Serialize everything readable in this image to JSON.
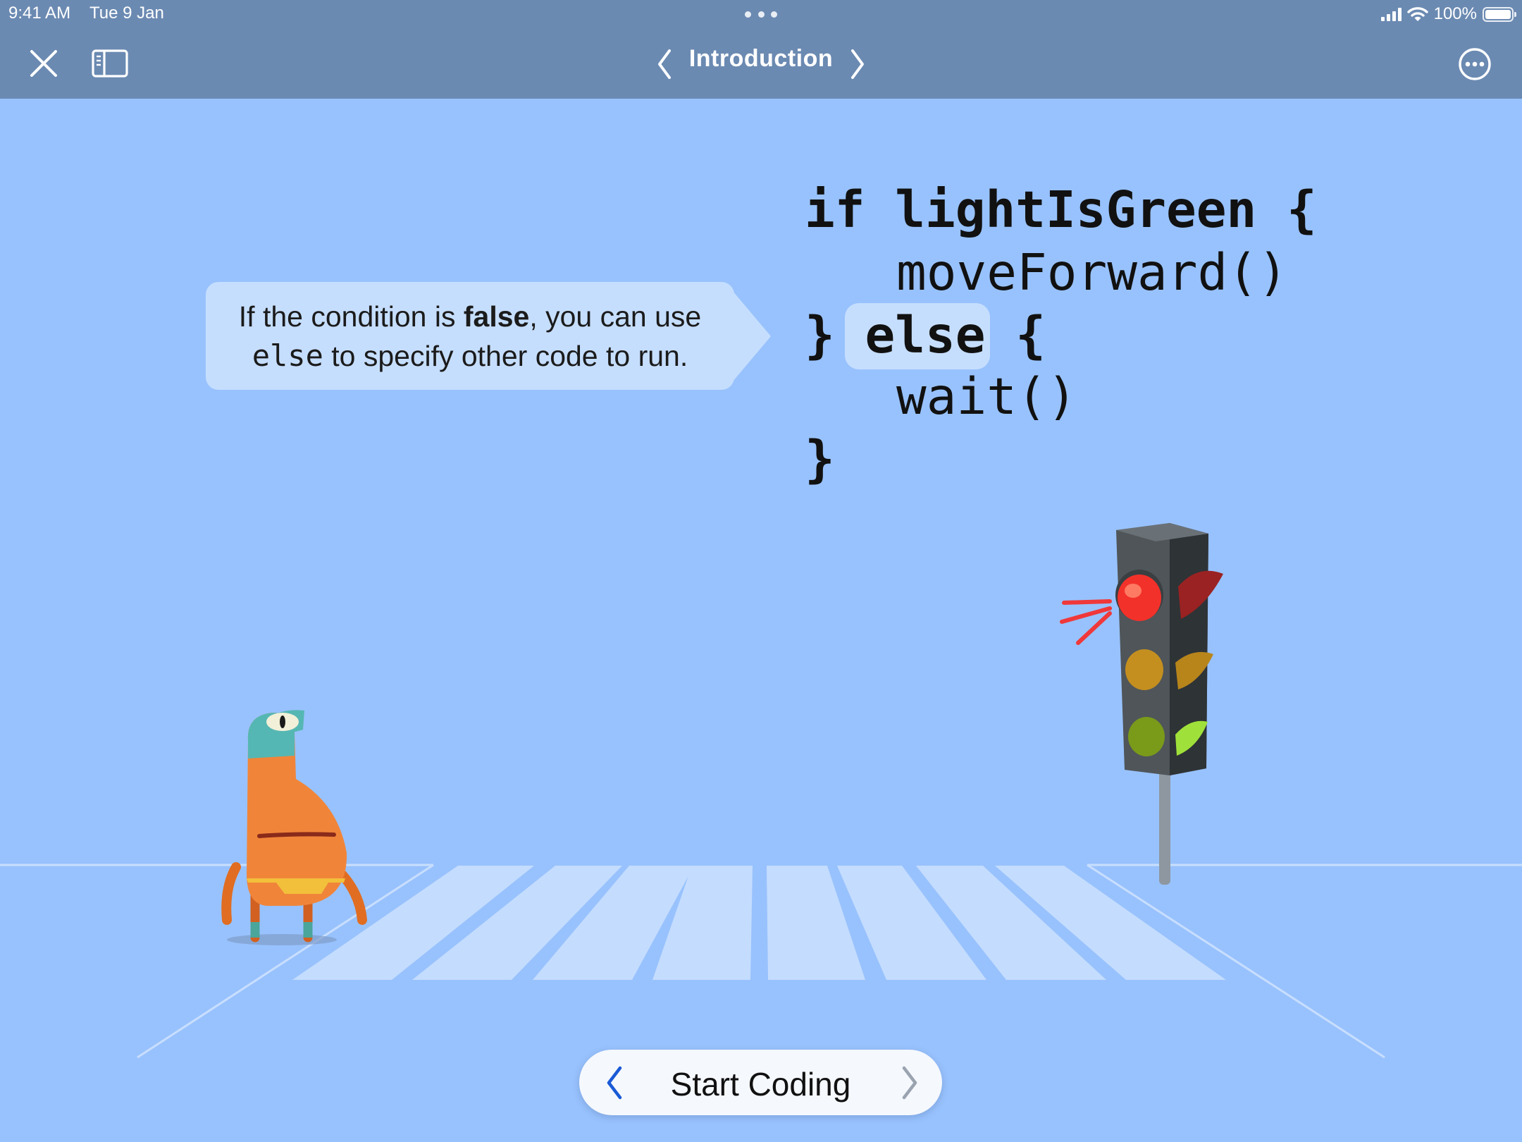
{
  "status_bar": {
    "time": "9:41 AM",
    "date": "Tue 9 Jan",
    "battery": "100%",
    "icons": [
      "signal-icon",
      "wifi-icon",
      "battery-icon"
    ]
  },
  "nav": {
    "title": "Introduction",
    "close_icon": "close-icon",
    "sidebar_icon": "sidebar-toggle-icon",
    "prev_icon": "chevron-left-icon",
    "next_icon": "chevron-right-icon",
    "more_icon": "ellipsis-circle-icon"
  },
  "callout": {
    "part1": "If the condition is ",
    "bold": "false",
    "part2": ", you can use",
    "code_word": "else",
    "part3": " to specify other code to run."
  },
  "code": {
    "line1_keyword": "if",
    "line1_condition": "lightIsGreen",
    "line1_brace": "{",
    "line2": "moveForward()",
    "line3_close": "}",
    "line3_keyword": "else",
    "line3_brace": "{",
    "line4": "wait()",
    "line5": "}"
  },
  "bottom": {
    "start_label": "Start Coding",
    "prev_icon": "chevron-left-icon",
    "next_icon": "chevron-right-icon"
  },
  "colors": {
    "background": "#98c2fd",
    "bar": "#6b8ab2",
    "callout": "#c6defe",
    "accent": "#1a5ad6",
    "light_red": "#f2312a",
    "light_amber": "#c48f1f",
    "light_green": "#7a9a1a"
  }
}
